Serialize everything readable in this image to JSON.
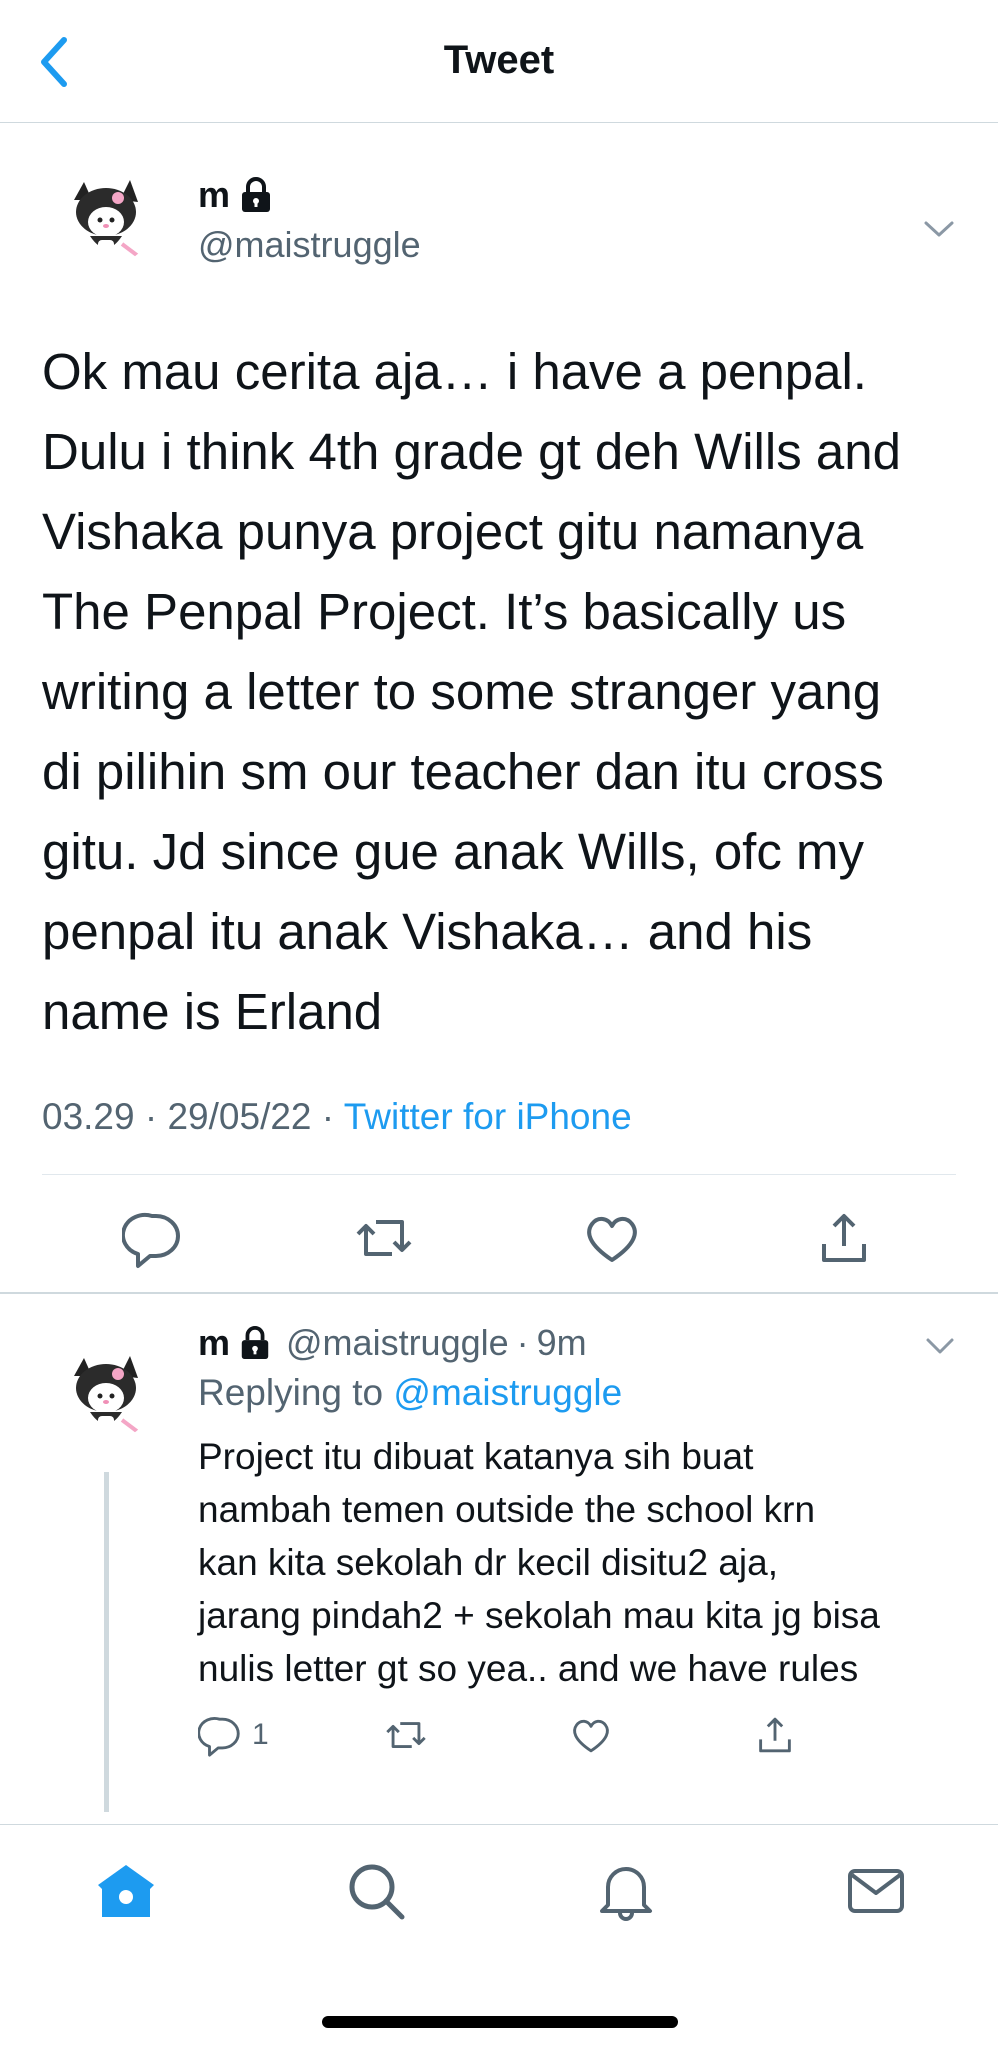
{
  "header": {
    "title": "Tweet"
  },
  "main_tweet": {
    "display_name": "m",
    "handle": "@maistruggle",
    "text_lines": [
      "Ok mau cerita aja… i have a penpal.",
      "Dulu i think 4th grade gt deh Wills and",
      "Vishaka punya project gitu namanya",
      "The Penpal Project. It’s basically us",
      "writing a letter to some stranger yang",
      "di pilihin sm our teacher dan itu cross",
      "gitu. Jd since gue anak Wills, ofc my",
      "penpal itu anak Vishaka… and his",
      "name is Erland"
    ],
    "time": "03.29",
    "date": "29/05/22",
    "separator": "·",
    "source": "Twitter for iPhone"
  },
  "reply": {
    "display_name": "m",
    "handle": "@maistruggle",
    "separator": "·",
    "age": "9m",
    "replying_label": "Replying to",
    "replying_to": "@maistruggle",
    "text_lines": [
      "Project itu dibuat katanya sih buat",
      "nambah temen outside the school krn",
      "kan kita sekolah dr kecil disitu2 aja,",
      "jarang pindah2 + sekolah mau kita jg bisa",
      "nulis letter gt so yea.. and we have rules"
    ],
    "reply_count": "1"
  },
  "tabbar": {
    "tabs": [
      "home-icon",
      "search-icon",
      "notifications-icon",
      "messages-icon"
    ],
    "active": "home-icon"
  },
  "colors": {
    "accent": "#1d9bf0",
    "secondary_text": "#536471",
    "divider": "#cfd9de"
  }
}
